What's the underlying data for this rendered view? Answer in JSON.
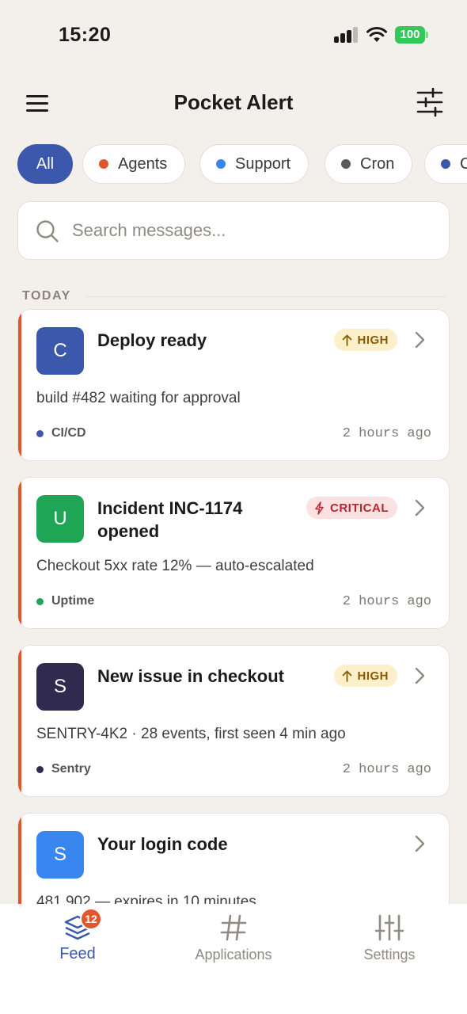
{
  "status_bar": {
    "time": "15:20",
    "battery": "100"
  },
  "header": {
    "title": "Pocket Alert"
  },
  "filters": [
    {
      "label": "All",
      "dot": null
    },
    {
      "label": "Agents",
      "dot": "#e2562e"
    },
    {
      "label": "Support",
      "dot": "#3a86f0"
    },
    {
      "label": "Cron",
      "dot": "#5b5b5b"
    },
    {
      "label": "C",
      "dot": "#3b58ad"
    }
  ],
  "search": {
    "placeholder": "Search messages..."
  },
  "section": {
    "label": "TODAY"
  },
  "cards": [
    {
      "avatar": "C",
      "avatar_color": "#3b58ad",
      "title": "Deploy ready",
      "priority": "HIGH",
      "body": "build #482 waiting for approval",
      "source": "CI/CD",
      "source_color": "#3b58ad",
      "time": "2 hours ago"
    },
    {
      "avatar": "U",
      "avatar_color": "#1fa654",
      "title": "Incident INC-1174 opened",
      "priority": "CRITICAL",
      "body": "Checkout 5xx rate 12% — auto-escalated",
      "source": "Uptime",
      "source_color": "#1fa654",
      "time": "2 hours ago"
    },
    {
      "avatar": "S",
      "avatar_color": "#302a4f",
      "title": "New issue in checkout",
      "priority": "HIGH",
      "body": "SENTRY-4K2 · 28 events, first seen 4 min ago",
      "source": "Sentry",
      "source_color": "#302a4f",
      "time": "2 hours ago"
    },
    {
      "avatar": "S",
      "avatar_color": "#3a86f0",
      "title": "Your login code",
      "priority": "",
      "body": "481 902 — expires in 10 minutes",
      "source": "",
      "source_color": "#3a86f0",
      "time": ""
    }
  ],
  "tabbar": {
    "feed": "Feed",
    "feed_badge": "12",
    "applications": "Applications",
    "settings": "Settings"
  },
  "colors": {
    "accent": "#3b58ad",
    "urgent": "#e2562e",
    "background": "#f3f0eb"
  }
}
